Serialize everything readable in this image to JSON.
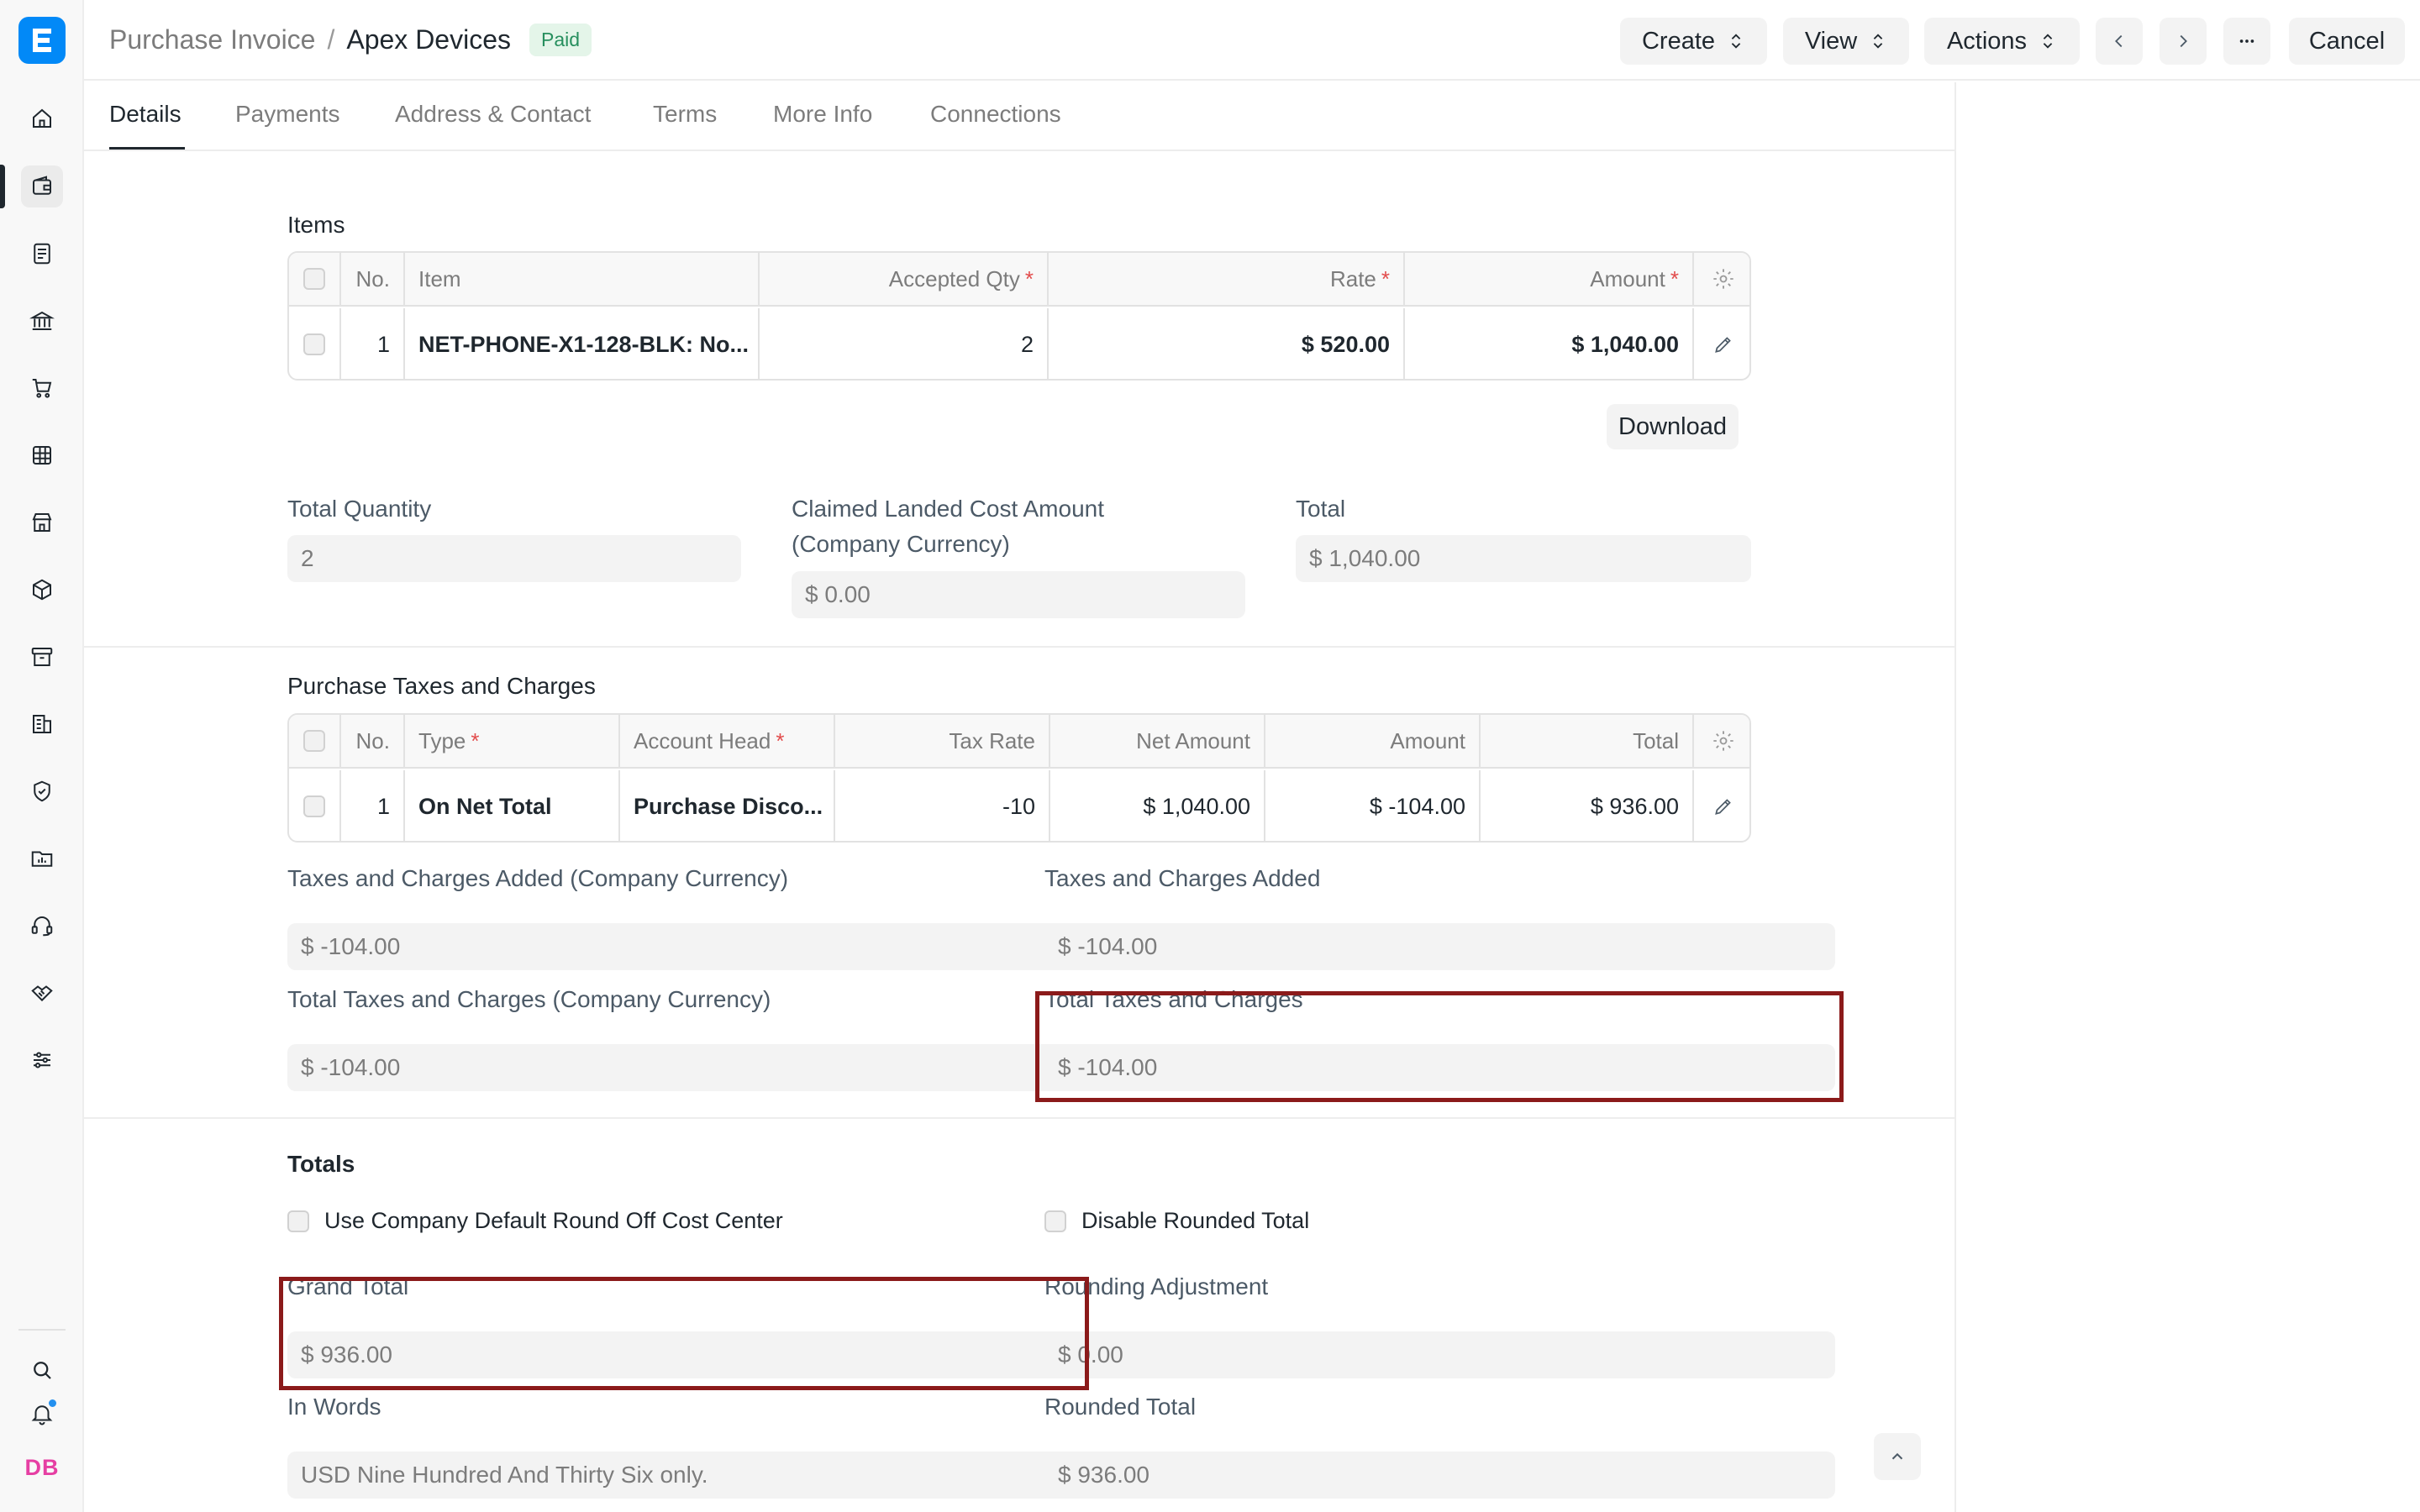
{
  "user": {
    "initials": "DB"
  },
  "header": {
    "doctype": "Purchase Invoice",
    "separator": "/",
    "title": "Apex Devices",
    "status": "Paid",
    "create_label": "Create",
    "view_label": "View",
    "actions_label": "Actions",
    "cancel_label": "Cancel"
  },
  "tabs": [
    "Details",
    "Payments",
    "Address & Contact",
    "Terms",
    "More Info",
    "Connections"
  ],
  "items_section": {
    "label": "Items",
    "columns": {
      "no": "No.",
      "item": "Item",
      "qty": "Accepted Qty",
      "rate": "Rate",
      "amount": "Amount"
    },
    "rows": [
      {
        "no": "1",
        "item": "NET-PHONE-X1-128-BLK: No...",
        "qty": "2",
        "rate": "$ 520.00",
        "amount": "$ 1,040.00"
      }
    ],
    "download_label": "Download"
  },
  "quantity_section": {
    "total_qty_label": "Total Quantity",
    "total_qty_value": "2",
    "landed_label_1": "Claimed Landed Cost Amount",
    "landed_label_2": "(Company Currency)",
    "landed_value": "$ 0.00",
    "total_label": "Total",
    "total_value": "$ 1,040.00"
  },
  "taxes_section": {
    "label": "Purchase Taxes and Charges",
    "columns": {
      "no": "No.",
      "type": "Type",
      "account": "Account Head",
      "rate": "Tax Rate",
      "net": "Net Amount",
      "amount": "Amount",
      "total": "Total"
    },
    "rows": [
      {
        "no": "1",
        "type": "On Net Total",
        "account": "Purchase Disco...",
        "rate": "-10",
        "net": "$ 1,040.00",
        "amount": "$ -104.00",
        "total": "$ 936.00"
      }
    ],
    "added_company_label": "Taxes and Charges Added (Company Currency)",
    "added_company_value": "$ -104.00",
    "added_label": "Taxes and Charges Added",
    "added_value": "$ -104.00",
    "total_company_label": "Total Taxes and Charges (Company Currency)",
    "total_company_value": "$ -104.00",
    "total_label": "Total Taxes and Charges",
    "total_value": "$ -104.00"
  },
  "totals_section": {
    "title": "Totals",
    "round_off_label": "Use Company Default Round Off Cost Center",
    "disable_rounded_label": "Disable Rounded Total",
    "grand_total_label": "Grand Total",
    "grand_total_value": "$ 936.00",
    "rounding_adjustment_label": "Rounding Adjustment",
    "rounding_adjustment_value": "$ 0.00",
    "in_words_label": "In Words",
    "in_words_value": "USD Nine Hundred And Thirty Six only.",
    "rounded_total_label": "Rounded Total",
    "rounded_total_value": "$ 936.00"
  },
  "colors": {
    "accent": "#0289f7",
    "status_paid_bg": "#e4f5e9",
    "status_paid_text": "#278f5e",
    "highlight": "#8b1a1a"
  }
}
